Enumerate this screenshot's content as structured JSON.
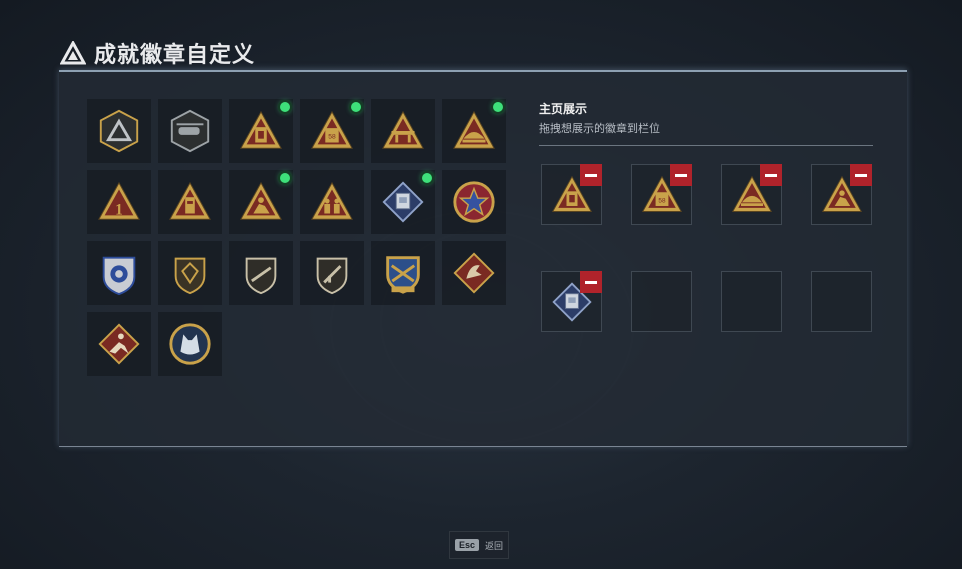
{
  "header": {
    "title": "成就徽章自定义",
    "logo_icon": "triangle-logo-icon"
  },
  "colors": {
    "gold": "#c9a24a",
    "red": "#7a2a22",
    "green_dot": "#3ee07a",
    "remove": "#b0232b"
  },
  "badges": [
    {
      "icon": "hex-shield-triangle-icon",
      "new": false
    },
    {
      "icon": "hex-shield-helicopter-icon",
      "new": false
    },
    {
      "icon": "triangle-door-icon",
      "new": true
    },
    {
      "icon": "triangle-door-58-icon",
      "new": true
    },
    {
      "icon": "triangle-bridge-icon",
      "new": false
    },
    {
      "icon": "triangle-boat-icon",
      "new": true
    },
    {
      "icon": "triangle-number-1-icon",
      "new": false
    },
    {
      "icon": "triangle-tower-icon",
      "new": false
    },
    {
      "icon": "triangle-climber-icon",
      "new": true
    },
    {
      "icon": "triangle-soldiers-icon",
      "new": false
    },
    {
      "icon": "diamond-gem-icon",
      "new": true
    },
    {
      "icon": "star-emblem-icon",
      "new": false
    },
    {
      "icon": "police-shield-icon",
      "new": false
    },
    {
      "icon": "shield-gem-icon",
      "new": false
    },
    {
      "icon": "shield-rifle-icon",
      "new": false
    },
    {
      "icon": "shield-rifle-2-icon",
      "new": false
    },
    {
      "icon": "shield-crossed-rifles-icon",
      "new": false
    },
    {
      "icon": "diamond-dragon-icon",
      "new": false
    },
    {
      "icon": "diamond-runner-icon",
      "new": false
    },
    {
      "icon": "round-wolf-icon",
      "new": false
    }
  ],
  "side": {
    "title": "主页展示",
    "subtitle": "拖拽想展示的徽章到栏位",
    "slots": [
      {
        "icon": "triangle-door-icon"
      },
      {
        "icon": "triangle-door-58-icon"
      },
      {
        "icon": "triangle-boat-icon"
      },
      {
        "icon": "triangle-climber-icon"
      },
      {
        "icon": "diamond-gem-icon"
      },
      {
        "icon": ""
      },
      {
        "icon": ""
      },
      {
        "icon": ""
      }
    ]
  },
  "footer": {
    "esc_key": "Esc",
    "esc_label": "返回"
  }
}
